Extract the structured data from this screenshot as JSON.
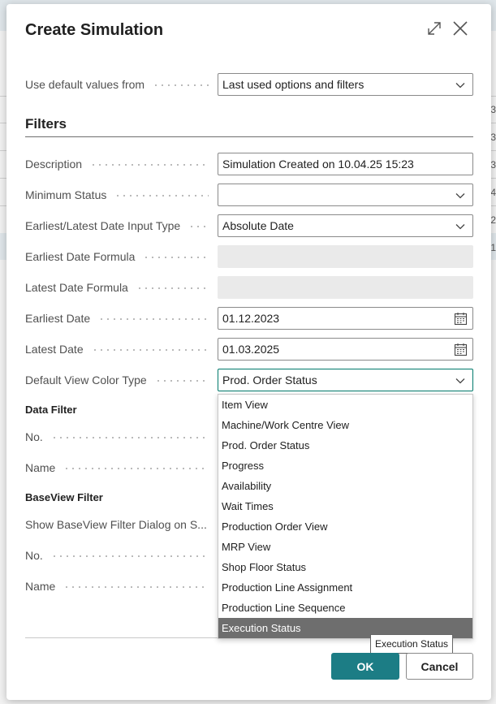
{
  "dialog": {
    "title": "Create Simulation",
    "expand_icon": "expand-icon",
    "close_icon": "close-icon"
  },
  "defaults": {
    "label": "Use default values from",
    "value": "Last used options and filters"
  },
  "filters": {
    "title": "Filters",
    "description_label": "Description",
    "description_value": "Simulation Created on 10.04.25 15:23",
    "minimum_status_label": "Minimum Status",
    "minimum_status_value": "",
    "date_input_type_label": "Earliest/Latest Date Input Type",
    "date_input_type_value": "Absolute Date",
    "earliest_formula_label": "Earliest Date Formula",
    "latest_formula_label": "Latest Date Formula",
    "earliest_date_label": "Earliest Date",
    "earliest_date_value": "01.12.2023",
    "latest_date_label": "Latest Date",
    "latest_date_value": "01.03.2025",
    "color_type_label": "Default View Color Type",
    "color_type_value": "Prod. Order Status"
  },
  "data_filter": {
    "title": "Data Filter",
    "no_label": "No.",
    "name_label": "Name"
  },
  "baseview_filter": {
    "title": "BaseView Filter",
    "show_dialog_label": "Show BaseView Filter Dialog on S...",
    "no_label": "No.",
    "name_label": "Name"
  },
  "dropdown": {
    "items": [
      "Item View",
      "Machine/Work Centre View",
      "Prod. Order Status",
      "Progress",
      "Availability",
      "Wait Times",
      "Production Order View",
      "MRP View",
      "Shop Floor Status",
      "Production Line Assignment",
      "Production Line Sequence",
      "Execution Status"
    ],
    "highlighted": "Execution Status"
  },
  "tooltip": "Execution Status",
  "buttons": {
    "ok": "OK",
    "cancel": "Cancel"
  },
  "background": {
    "digits": [
      "3",
      "3",
      "3",
      "4",
      "2",
      "1"
    ]
  },
  "colors": {
    "accent": "#1c7d85",
    "highlight": "#6e6e6e"
  }
}
